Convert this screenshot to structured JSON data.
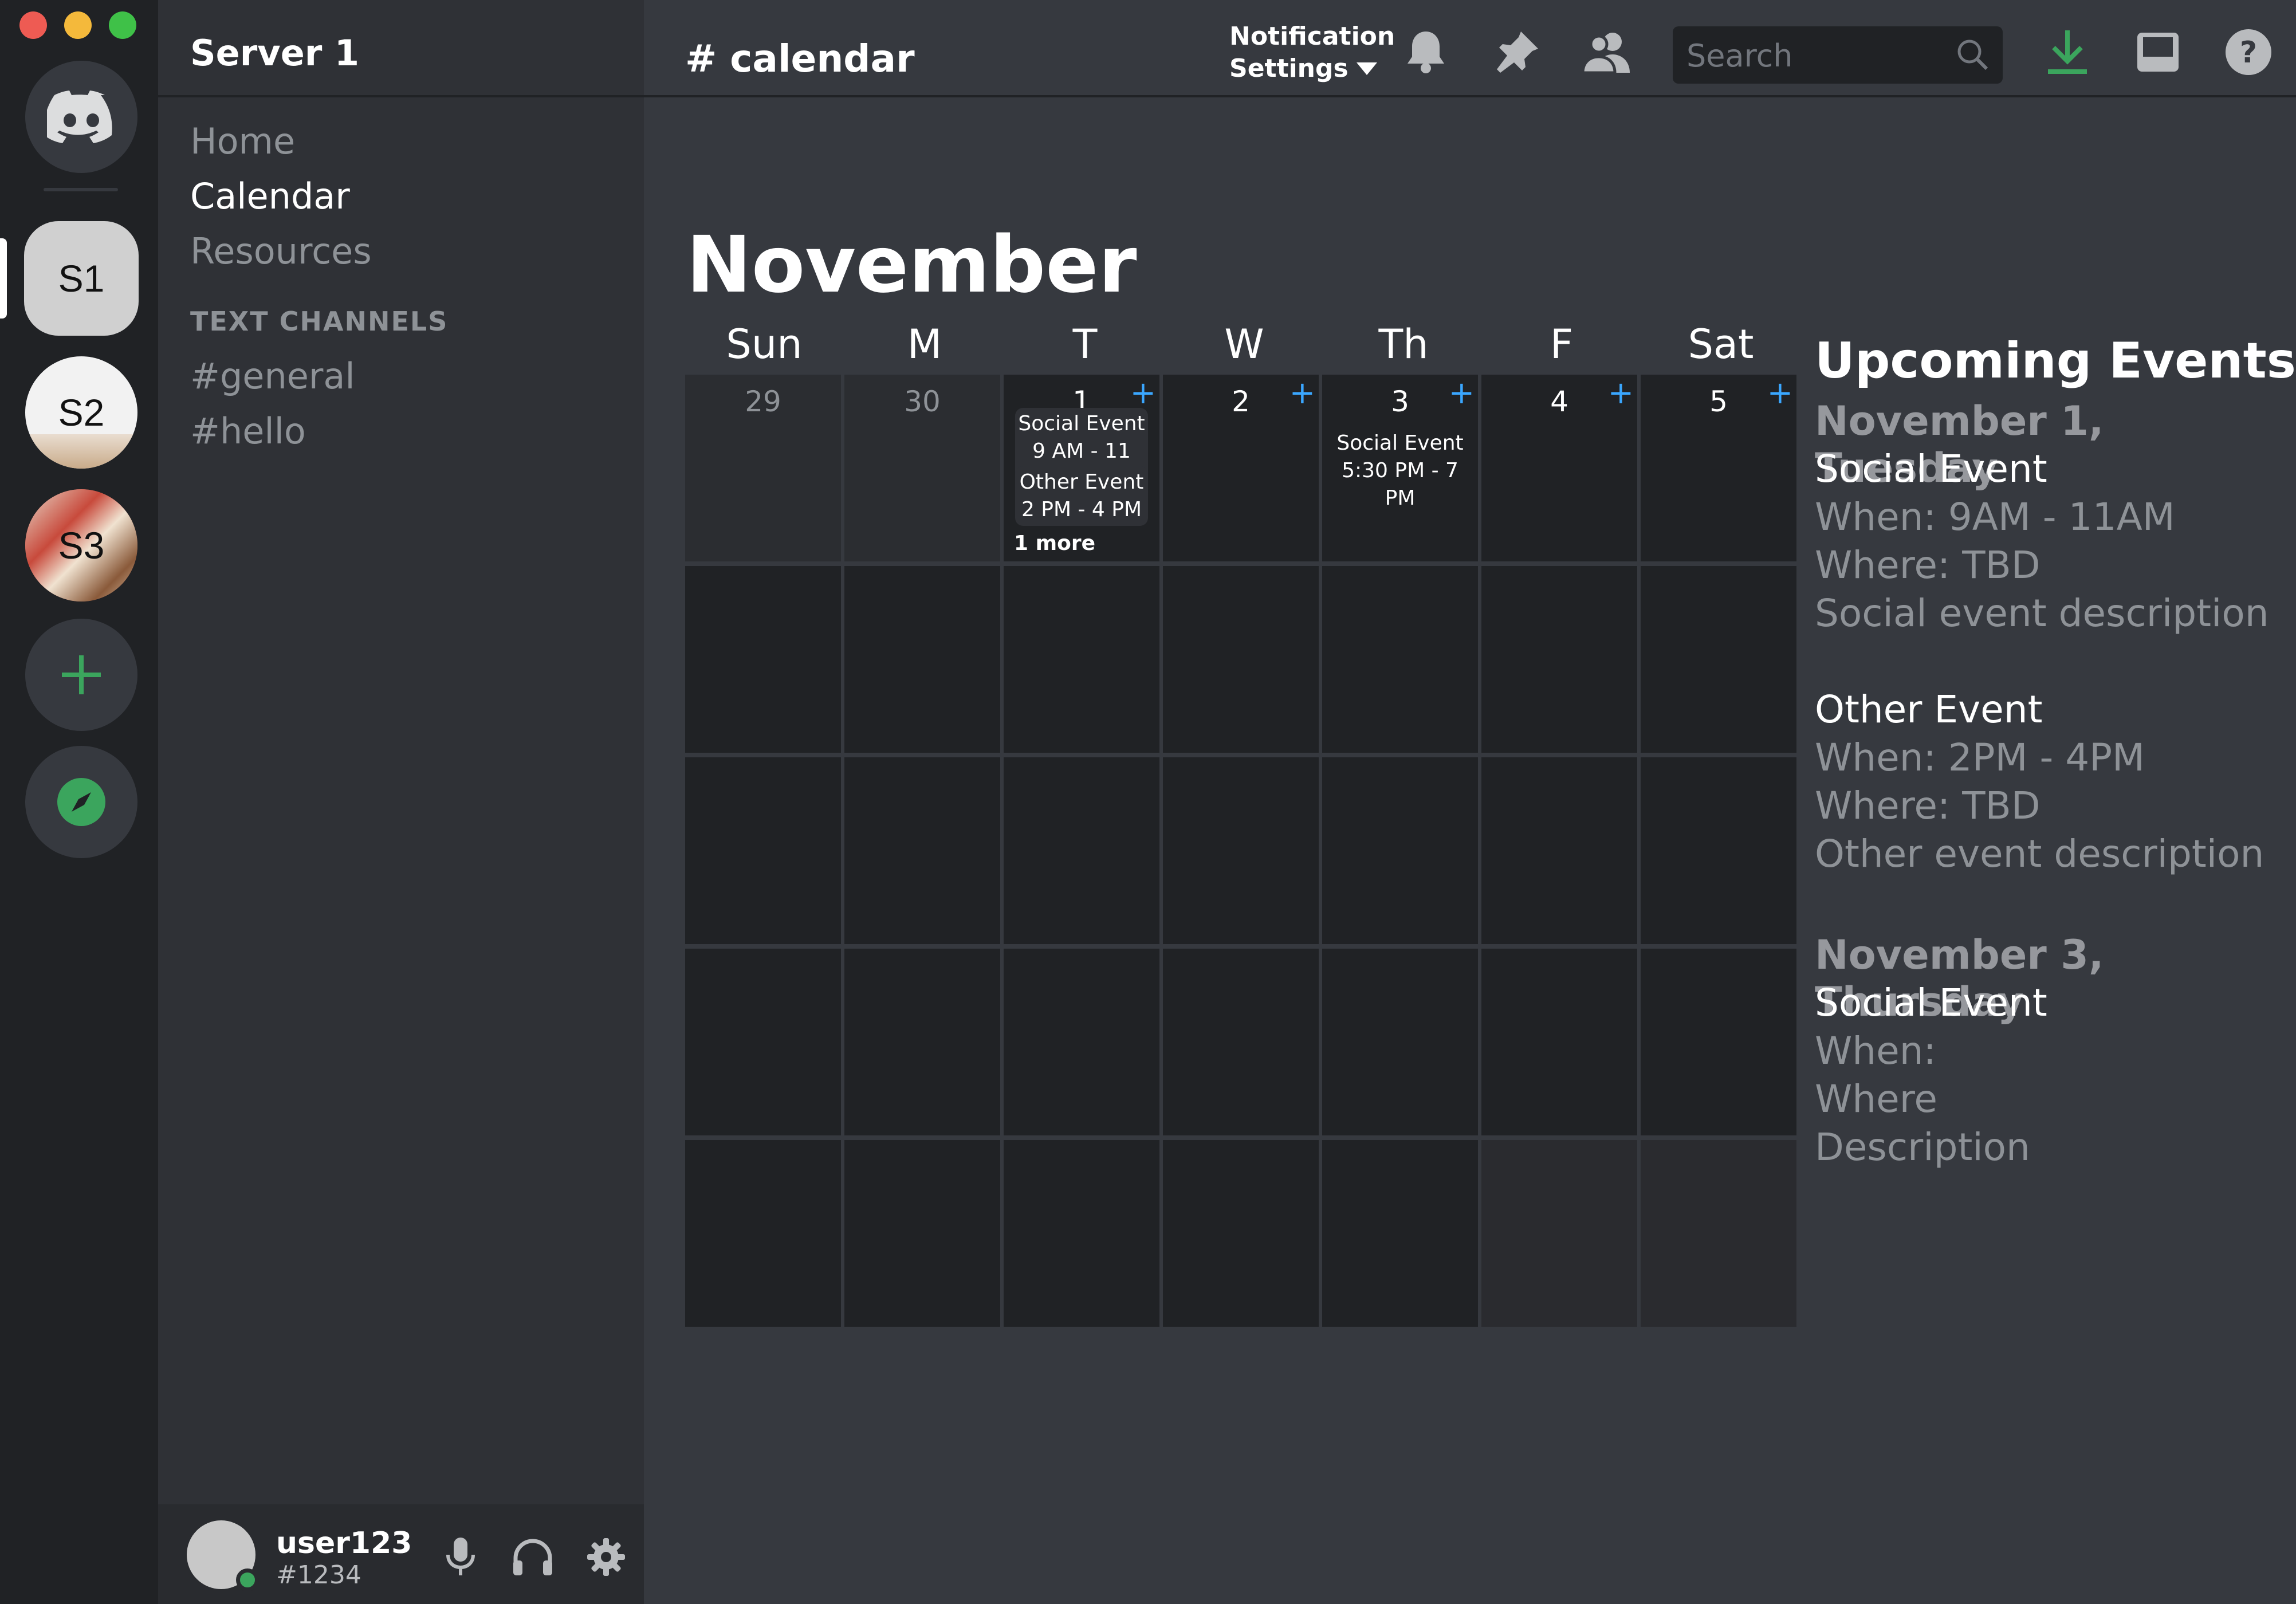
{
  "window": {
    "traffic_lights": [
      "#ee5b53",
      "#f4b93b",
      "#3fc148"
    ]
  },
  "servers": {
    "items": [
      {
        "name": "discord-home",
        "icon": "discord-logo-icon"
      },
      {
        "label": "S1",
        "active": true
      },
      {
        "label": "S2"
      },
      {
        "label": "S3"
      },
      {
        "name": "add-server",
        "icon": "plus-icon"
      },
      {
        "name": "explore",
        "icon": "compass-icon"
      }
    ]
  },
  "sidebar": {
    "server_name": "Server 1",
    "nav": [
      {
        "label": "Home",
        "active": false
      },
      {
        "label": "Calendar",
        "active": true
      },
      {
        "label": "Resources",
        "active": false
      }
    ],
    "section_title": "TEXT CHANNELS",
    "channels": [
      "#general",
      "#hello"
    ]
  },
  "user": {
    "name": "user123",
    "tag": "#1234",
    "status_color": "#3ba55d"
  },
  "header": {
    "channel": "# calendar",
    "notification_line1": "Notification",
    "notification_line2": "Settings",
    "search_placeholder": "Search",
    "icons": [
      "bell-icon",
      "pin-icon",
      "members-icon",
      "search-icon",
      "download-icon",
      "inbox-icon",
      "help-icon"
    ]
  },
  "calendar": {
    "month": "November",
    "weekdays": [
      "Sun",
      "M",
      "T",
      "W",
      "Th",
      "F",
      "Sat"
    ],
    "first_week": [
      {
        "day": "29",
        "outside": true
      },
      {
        "day": "30",
        "outside": true
      },
      {
        "day": "1",
        "events": [
          {
            "title": "Social Event",
            "time": "9 AM - 11 AM"
          },
          {
            "title": "Other Event",
            "time": "2 PM - 4 PM"
          }
        ],
        "more": "1 more"
      },
      {
        "day": "2"
      },
      {
        "day": "3",
        "events": [
          {
            "title": "Social Event",
            "time": "5:30 PM - 7 PM"
          }
        ]
      },
      {
        "day": "4"
      },
      {
        "day": "5"
      }
    ],
    "add_symbol": "+"
  },
  "upcoming": {
    "title": "Upcoming Events",
    "groups": [
      {
        "date": "November 1, Tuesday",
        "events": [
          {
            "name": "Social Event",
            "when": "When: 9AM - 11AM",
            "where": "Where: TBD",
            "description": "Social event description"
          },
          {
            "name": "Other Event",
            "when": "When: 2PM - 4PM",
            "where": "Where: TBD",
            "description": "Other event description"
          }
        ]
      },
      {
        "date": "November 3, Thursday",
        "events": [
          {
            "name": "Social Event",
            "when": "When:",
            "where": "Where",
            "description": "Description"
          }
        ]
      }
    ]
  }
}
